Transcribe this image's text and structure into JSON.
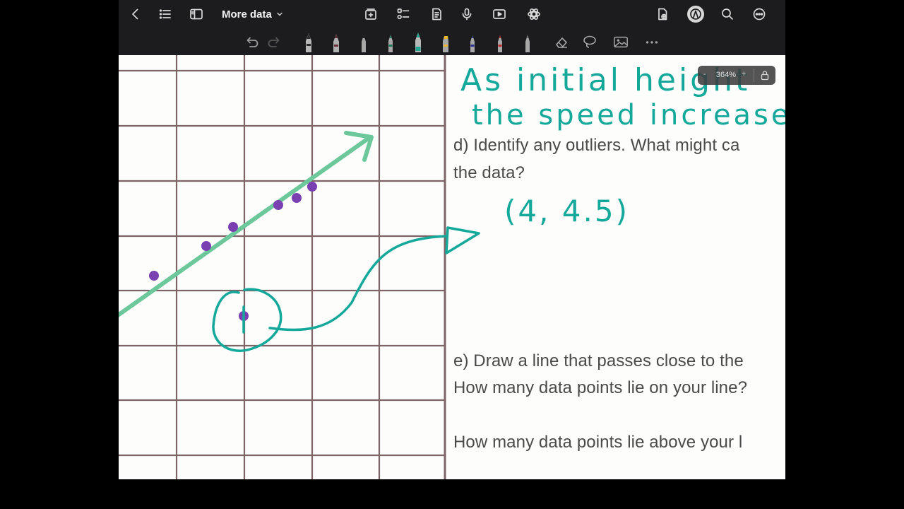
{
  "app": {
    "doc_title": "More data",
    "zoom": {
      "minus": "-",
      "value": "364%",
      "plus": "+"
    },
    "icons": {
      "left": [
        "back-chevron-icon",
        "outline-list-icon",
        "sidebar-icon"
      ],
      "center": [
        "add-page-icon",
        "checklist-icon",
        "page-template-icon",
        "microphone-icon",
        "video-play-icon",
        "ai-assistant-icon"
      ],
      "right": [
        "share-doc-icon",
        "pencil-mode-icon",
        "search-icon",
        "more-options-icon"
      ]
    },
    "tools": [
      "undo-icon",
      "redo-icon",
      "fountain-pen-tool",
      "pen-tool-maroon",
      "ballpoint-tool-black",
      "marker-tool-green",
      "marker-tool-teal",
      "highlighter-tool-yellow",
      "pen-tool-blue",
      "pen-tool-red",
      "pencil-tool-gray",
      "eraser-tool",
      "lasso-tool",
      "image-tool",
      "more-tools-icon"
    ]
  },
  "worksheet": {
    "question_d_line1": "d) Identify any outliers. What might ca",
    "question_d_line2": "the data?",
    "question_e_line1": "e) Draw a line that passes close to the",
    "question_e_line2": "How many data points lie on your line?",
    "question_e_line3": "How many data points lie above your l"
  },
  "handwriting": {
    "line1": "As initial height",
    "line2": "the speed increase",
    "outlier_answer": "(4, 4.5)"
  },
  "colors": {
    "ink_teal": "#14a89a",
    "trend_line_green": "#6cc79a",
    "point_purple": "#7a3fb0",
    "grid_maroon": "#6a4a4e"
  }
}
